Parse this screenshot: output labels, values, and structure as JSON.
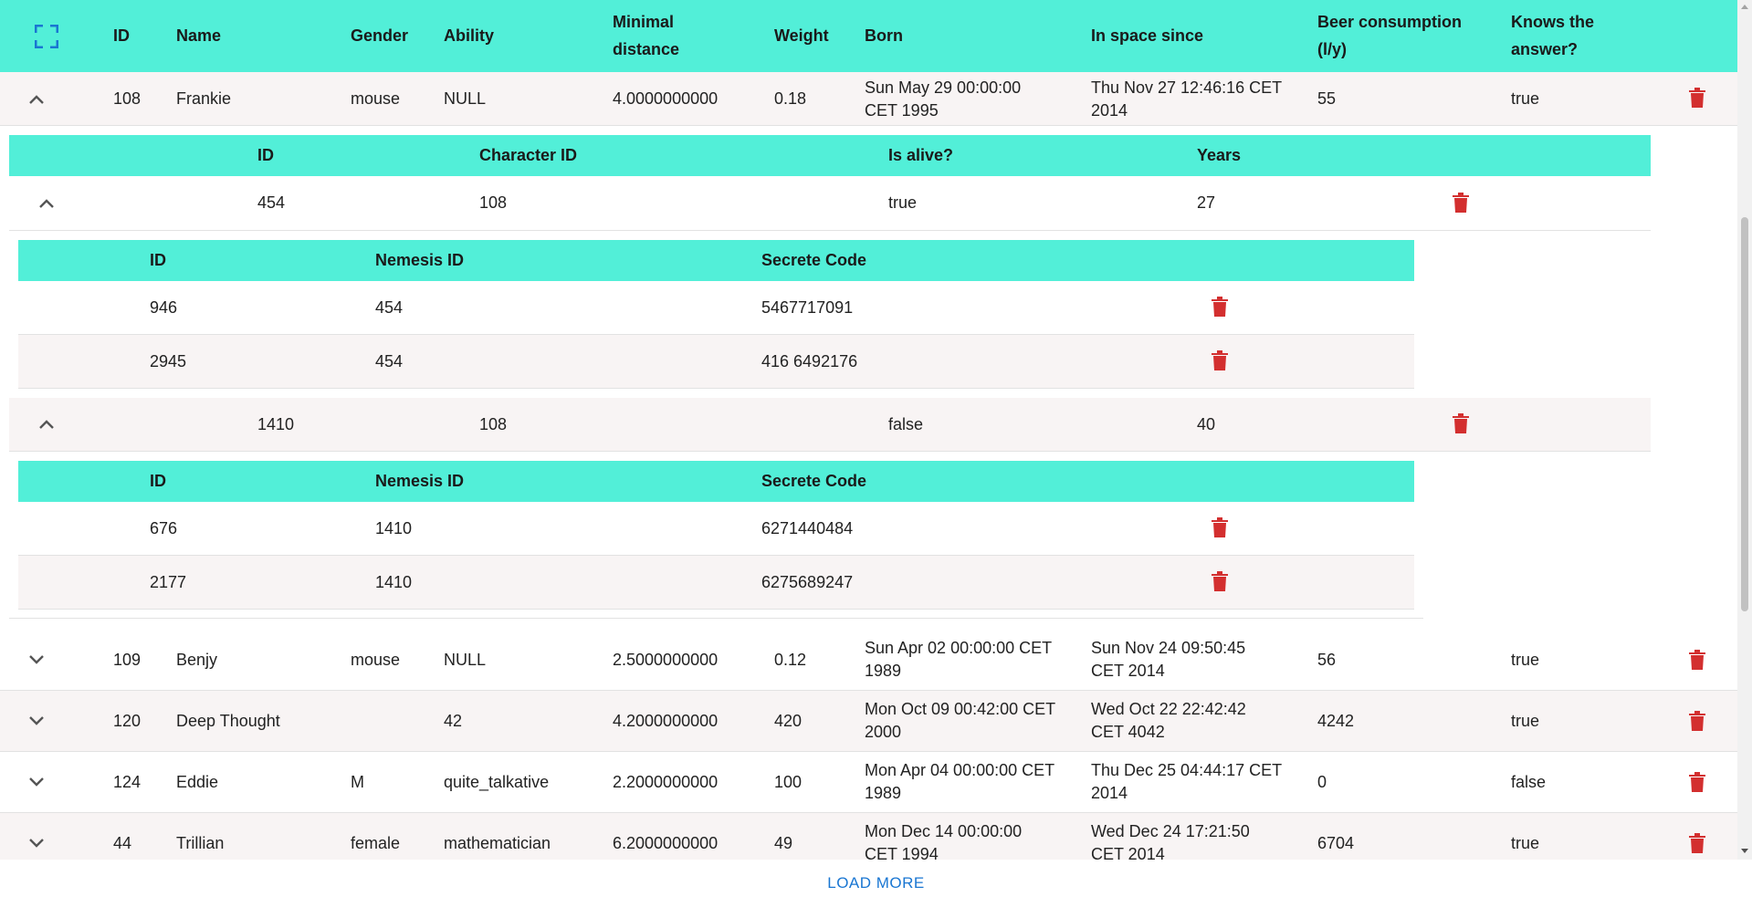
{
  "colors": {
    "header_bg": "#52efd8",
    "delete_red": "#d32f2f",
    "accent_blue": "#1976d2"
  },
  "main_table": {
    "columns": [
      "ID",
      "Name",
      "Gender",
      "Ability",
      "Minimal distance",
      "Weight",
      "Born",
      "In space since",
      "Beer consumption (l/y)",
      "Knows the answer?"
    ],
    "column_lines": {
      "minimal_distance": [
        "Minimal",
        "distance"
      ],
      "beer_consumption": [
        "Beer consumption",
        "(l/y)"
      ],
      "knows_answer": [
        "Knows the",
        "answer?"
      ]
    },
    "expanded_row": {
      "id": "108",
      "name": "Frankie",
      "gender": "mouse",
      "ability": "NULL",
      "minimal_distance": "4.0000000000",
      "weight": "0.18",
      "born": [
        "Sun May 29 00:00:00",
        "CET 1995"
      ],
      "in_space_since": [
        "Thu Nov 27 12:46:16 CET",
        "2014"
      ],
      "beer": "55",
      "knows": "true"
    },
    "rows": [
      {
        "id": "109",
        "name": "Benjy",
        "gender": "mouse",
        "ability": "NULL",
        "minimal_distance": "2.5000000000",
        "weight": "0.12",
        "born": [
          "Sun Apr 02 00:00:00 CET",
          "1989"
        ],
        "in_space_since": [
          "Sun Nov 24 09:50:45",
          "CET 2014"
        ],
        "beer": "56",
        "knows": "true"
      },
      {
        "id": "120",
        "name": "Deep Thought",
        "gender": "",
        "ability": "42",
        "minimal_distance": "4.2000000000",
        "weight": "420",
        "born": [
          "Mon Oct 09 00:42:00 CET",
          "2000"
        ],
        "in_space_since": [
          "Wed Oct 22 22:42:42",
          "CET 4042"
        ],
        "beer": "4242",
        "knows": "true"
      },
      {
        "id": "124",
        "name": "Eddie",
        "gender": "M",
        "ability": "quite_talkative",
        "minimal_distance": "2.2000000000",
        "weight": "100",
        "born": [
          "Mon Apr 04 00:00:00 CET",
          "1989"
        ],
        "in_space_since": [
          "Thu Dec 25 04:44:17 CET",
          "2014"
        ],
        "beer": "0",
        "knows": "false"
      },
      {
        "id": "44",
        "name": "Trillian",
        "gender": "female",
        "ability": "mathematician",
        "minimal_distance": "6.2000000000",
        "weight": "49",
        "born": [
          "Mon Dec 14 00:00:00",
          "CET 1994"
        ],
        "in_space_since": [
          "Wed Dec 24 17:21:50",
          "CET 2014"
        ],
        "beer": "6704",
        "knows": "true"
      }
    ]
  },
  "nested_table": {
    "columns": [
      "ID",
      "Character ID",
      "Is alive?",
      "Years"
    ],
    "rows": [
      {
        "id": "454",
        "character_id": "108",
        "is_alive": "true",
        "years": "27"
      },
      {
        "id": "1410",
        "character_id": "108",
        "is_alive": "false",
        "years": "40"
      }
    ]
  },
  "nemesis_tables": {
    "columns": [
      "ID",
      "Nemesis ID",
      "Secrete Code"
    ],
    "first": [
      {
        "id": "946",
        "nemesis_id": "454",
        "code": "5467717091"
      },
      {
        "id": "2945",
        "nemesis_id": "454",
        "code": "416 6492176"
      }
    ],
    "second": [
      {
        "id": "676",
        "nemesis_id": "1410",
        "code": "6271440484"
      },
      {
        "id": "2177",
        "nemesis_id": "1410",
        "code": "6275689247"
      }
    ]
  },
  "footer": {
    "load_more_label": "LOAD MORE"
  },
  "icons": {
    "fullscreen": "fullscreen-icon",
    "collapse": "chevron-up-icon",
    "expand": "chevron-down-icon",
    "delete": "trash-icon"
  }
}
